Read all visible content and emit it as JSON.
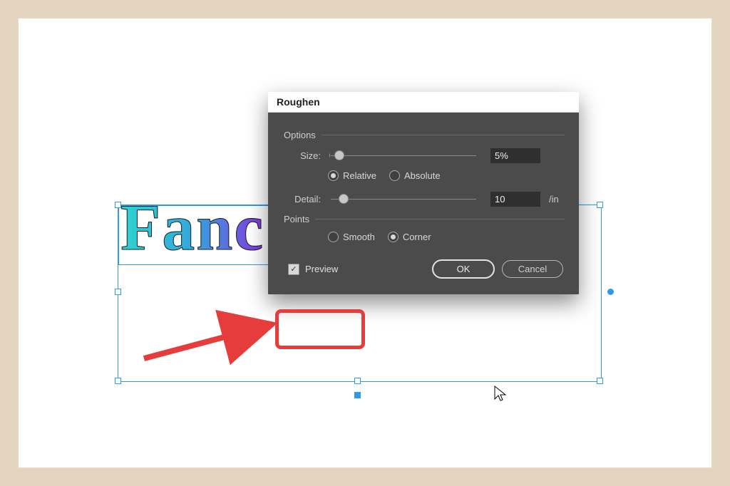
{
  "canvas": {
    "display_text": "Fanc"
  },
  "dialog": {
    "title": "Roughen",
    "sections": {
      "options_label": "Options",
      "points_label": "Points"
    },
    "size": {
      "label": "Size:",
      "value": "5%",
      "mode_relative": "Relative",
      "mode_absolute": "Absolute",
      "mode_selected": "relative"
    },
    "detail": {
      "label": "Detail:",
      "value": "10",
      "unit": "/in"
    },
    "points": {
      "smooth": "Smooth",
      "corner": "Corner",
      "selected": "corner"
    },
    "preview": {
      "label": "Preview",
      "checked": true
    },
    "buttons": {
      "ok": "OK",
      "cancel": "Cancel"
    }
  },
  "annotation": {
    "target": "preview-checkbox"
  }
}
